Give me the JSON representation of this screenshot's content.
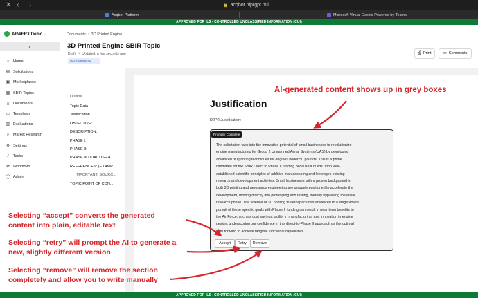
{
  "browser": {
    "url": "acqbot.niprgpt.mil",
    "tabs": [
      {
        "label": "Acqbot Platform",
        "favicon_color": "#4a7fe0"
      },
      {
        "label": "Microsoft Virtual Events Powered by Teams",
        "favicon_color": "#6a5fd1"
      }
    ],
    "close_icon": "close-icon",
    "back_icon": "chevron-left-icon",
    "forward_icon": "chevron-right-icon"
  },
  "banner": {
    "text": "APPROVED FOR IL5 - CONTROLLED UNCLASSIFIED INFORMATION (CUI)",
    "color": "#0f7a36"
  },
  "sidebar": {
    "org_name": "AFWERX Demo",
    "collapse_icon": "chevron-left-icon",
    "items": [
      {
        "label": "Home",
        "icon": "home-icon",
        "glyph": "⌂"
      },
      {
        "label": "Solicitations",
        "icon": "document-icon",
        "glyph": "▤"
      },
      {
        "label": "Marketplaces",
        "icon": "store-icon",
        "glyph": "▣"
      },
      {
        "label": "SBIR Topics",
        "icon": "topics-icon",
        "glyph": "▦"
      },
      {
        "label": "Documents",
        "icon": "file-icon",
        "glyph": "▯"
      },
      {
        "label": "Templates",
        "icon": "template-icon",
        "glyph": "▭"
      },
      {
        "label": "Evaluations",
        "icon": "clipboard-icon",
        "glyph": "▥"
      },
      {
        "label": "Market Research",
        "icon": "search-icon",
        "glyph": "⌕"
      },
      {
        "label": "Settings",
        "icon": "gear-icon",
        "glyph": "⚙"
      },
      {
        "label": "Tasks",
        "icon": "check-icon",
        "glyph": "✓"
      },
      {
        "label": "Workflows",
        "icon": "workflow-icon",
        "glyph": "⇄"
      },
      {
        "label": "Admin",
        "icon": "user-icon",
        "glyph": "◯"
      }
    ]
  },
  "header": {
    "breadcrumb": [
      "Documents",
      "3D Printed Engine..."
    ],
    "title": "3D Printed Engine SBIR Topic",
    "status": "Draft",
    "updated": "Updated: a few seconds ago",
    "tag": "AFWERX De...",
    "print_label": "Print",
    "comments_label": "Comments"
  },
  "outline": {
    "title": "Outline",
    "items": [
      {
        "label": "Topic Data",
        "sub": false
      },
      {
        "label": "Justification",
        "sub": false
      },
      {
        "label": "OBJECTIVE:",
        "sub": false
      },
      {
        "label": "DESCRIPTION:",
        "sub": false
      },
      {
        "label": "PHASE I:",
        "sub": false
      },
      {
        "label": "PHASE II:",
        "sub": false
      },
      {
        "label": "PHASE III DUAL USE A...",
        "sub": false
      },
      {
        "label": "REFERENCES: (EXAMP...",
        "sub": false
      },
      {
        "label": "IMPORTANT: SOURC...",
        "sub": true
      },
      {
        "label": "TOPIC POINT OF CON...",
        "sub": false
      }
    ]
  },
  "document": {
    "heading": "Justification",
    "sub_label": "D2P2 Justification:",
    "prompt_label": "Prompt / Complete",
    "ai_lines": [
      "The solicitation taps into the innovative potential of small businesses to revolutionize",
      "engine manufacturing for Group 2 Unmanned Aerial Systems (UAS) by developing",
      "advanced 3D printing techniques for engines under 50 pounds. This is a prime",
      "candidate for the SBIR Direct to Phase II funding because it builds upon well-",
      "established scientific principles of additive manufacturing and leverages existing",
      "research and development activities. Small businesses with a proven background in",
      "both 3D printing and aerospace engineering are uniquely positioned to accelerate the",
      "development, moving directly into prototyping and testing, thereby bypassing the initial",
      "research phase. The science of 3D printing in aerospace has advanced to a stage where",
      "pursuit of these specific goals with Phase II funding can result in near-term benefits to",
      "the Air Force, such as cost savings, agility in manufacturing, and innovation in engine",
      "design, underscoring our confidence in this direct-to-Phase II approach as the optimal",
      "path forward to achieve tangible functional capabilities."
    ],
    "accept_label": "Accept",
    "retry_label": "Retry",
    "remove_label": "Remove"
  },
  "annotations": {
    "title": "AI-generated content shows up in grey boxes",
    "accept_lines": [
      "Selecting “accept” converts the generated",
      "content into plain, editable text"
    ],
    "retry_lines": [
      "Selecting “retry” will prompt the AI to generate a",
      "new, slightly different version"
    ],
    "remove_lines": [
      "Selecting “remove” will remove the section",
      "completely and allow you to write manually"
    ],
    "color": "#d6262c"
  }
}
